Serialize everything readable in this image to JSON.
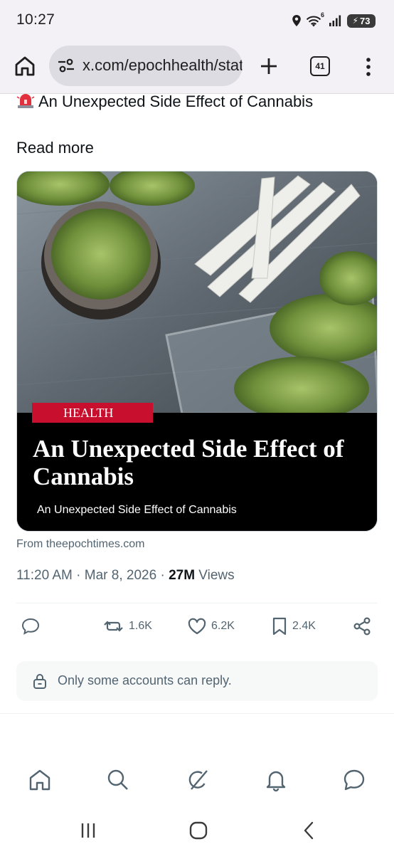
{
  "status_bar": {
    "time": "10:27",
    "wifi_badge": "6",
    "battery": "73",
    "icons": [
      "location-icon",
      "wifi-icon",
      "signal-icon",
      "battery-charging-icon"
    ]
  },
  "browser": {
    "url": "x.com/epochhealth/status",
    "tab_count": "41",
    "icons": [
      "home-icon",
      "site-settings-icon",
      "new-tab-plus-icon",
      "tabs-icon",
      "more-menu-icon"
    ]
  },
  "post": {
    "headline_line": "An Unexpected Side Effect of Cannabis",
    "emoji": "police-siren-emoji",
    "read_more": "Read more",
    "card": {
      "badge": "HEALTH",
      "title": "An Unexpected Side Effect of Cannabis",
      "subtitle": "An Unexpected Side Effect of Cannabis",
      "image_subject": "cannabis-grinder-and-joints-photo"
    },
    "from_label": "From theepochtimes.com",
    "time": "11:20 AM",
    "date": "Mar 8, 2026",
    "separator": " · ",
    "views_count": "27M",
    "views_label": " Views",
    "actions": {
      "reposts": "1.6K",
      "likes": "6.2K",
      "bookmarks": "2.4K"
    },
    "reply_restriction": "Only some accounts can reply."
  },
  "bottom_nav": {
    "items": [
      "home-icon",
      "search-icon",
      "grok-icon",
      "notifications-bell-icon",
      "messages-icon"
    ]
  },
  "system_nav": {
    "items": [
      "recent-apps-icon",
      "home-circle-icon",
      "back-icon"
    ]
  },
  "colors": {
    "text_primary": "#0f1419",
    "text_secondary": "#536471",
    "badge_red": "#c8102e",
    "browser_chrome": "#f3f1f6"
  }
}
